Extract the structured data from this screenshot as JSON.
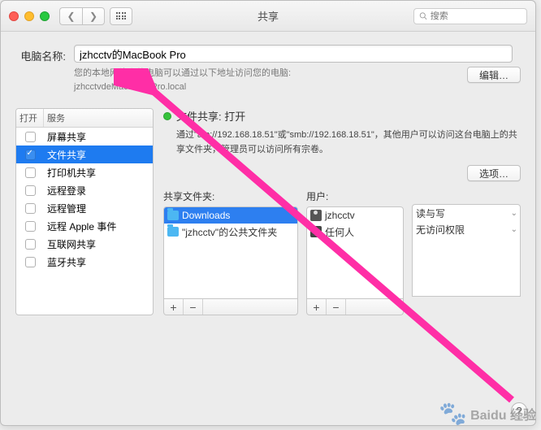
{
  "window": {
    "title": "共享"
  },
  "search": {
    "placeholder": "搜索"
  },
  "name_section": {
    "label": "电脑名称:",
    "value": "jzhcctv的MacBook Pro",
    "hint_line1": "您的本地网络上的电脑可以通过以下地址访问您的电脑:",
    "hint_line2": "jzhcctvdeMacBook-Pro.local",
    "edit_btn": "编辑…"
  },
  "services": {
    "col_on": "打开",
    "col_service": "服务",
    "items": [
      {
        "label": "屏幕共享",
        "on": false,
        "selected": false
      },
      {
        "label": "文件共享",
        "on": true,
        "selected": true
      },
      {
        "label": "打印机共享",
        "on": false,
        "selected": false
      },
      {
        "label": "远程登录",
        "on": false,
        "selected": false
      },
      {
        "label": "远程管理",
        "on": false,
        "selected": false
      },
      {
        "label": "远程 Apple 事件",
        "on": false,
        "selected": false
      },
      {
        "label": "互联网共享",
        "on": false,
        "selected": false
      },
      {
        "label": "蓝牙共享",
        "on": false,
        "selected": false
      }
    ]
  },
  "detail": {
    "status_title": "文件共享: 打开",
    "desc_a": "通过\"afp://192.168.18.51\"或\"smb://192.168.18.51\"，其他用户可以访问这台电脑上的共享文件夹，管理员可以访问所有宗卷。",
    "options_btn": "选项…",
    "folders_label": "共享文件夹:",
    "users_label": "用户:",
    "folders": [
      {
        "name": "Downloads",
        "selected": true
      },
      {
        "name": "\"jzhcctv\"的公共文件夹",
        "selected": false
      }
    ],
    "users": [
      {
        "name": "jzhcctv",
        "perm": "读与写",
        "icon": "single"
      },
      {
        "name": "任何人",
        "perm": "无访问权限",
        "icon": "group"
      }
    ]
  },
  "watermark": {
    "brand": "Baidu 经验"
  }
}
